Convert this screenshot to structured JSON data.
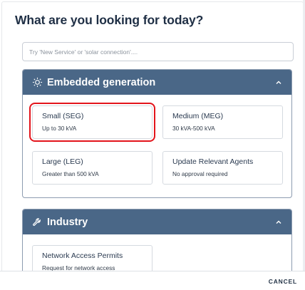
{
  "dialog": {
    "title": "What are you looking for today?",
    "search": {
      "placeholder": "Try 'New Service' or 'solar connection'....",
      "value": ""
    },
    "cancel_label": "CANCEL"
  },
  "colors": {
    "section_header": "#4a6787",
    "selection_outline": "#e3141b",
    "title_text": "#1f2f45"
  },
  "sections": [
    {
      "title": "Embedded generation",
      "icon": "sun-icon",
      "collapse_icon": "chevron-up-icon",
      "cards": [
        {
          "title": "Small (SEG)",
          "subtitle": "Up to 30 kVA",
          "selected": true
        },
        {
          "title": "Medium (MEG)",
          "subtitle": "30 kVA-500 kVA",
          "selected": false
        },
        {
          "title": "Large (LEG)",
          "subtitle": "Greater than 500 kVA",
          "selected": false
        },
        {
          "title": "Update Relevant Agents",
          "subtitle": "No approval required",
          "selected": false
        }
      ]
    },
    {
      "title": "Industry",
      "icon": "wrench-icon",
      "collapse_icon": "chevron-up-icon",
      "cards": [
        {
          "title": "Network Access Permits",
          "subtitle": "Request for network access",
          "selected": false
        }
      ]
    }
  ]
}
